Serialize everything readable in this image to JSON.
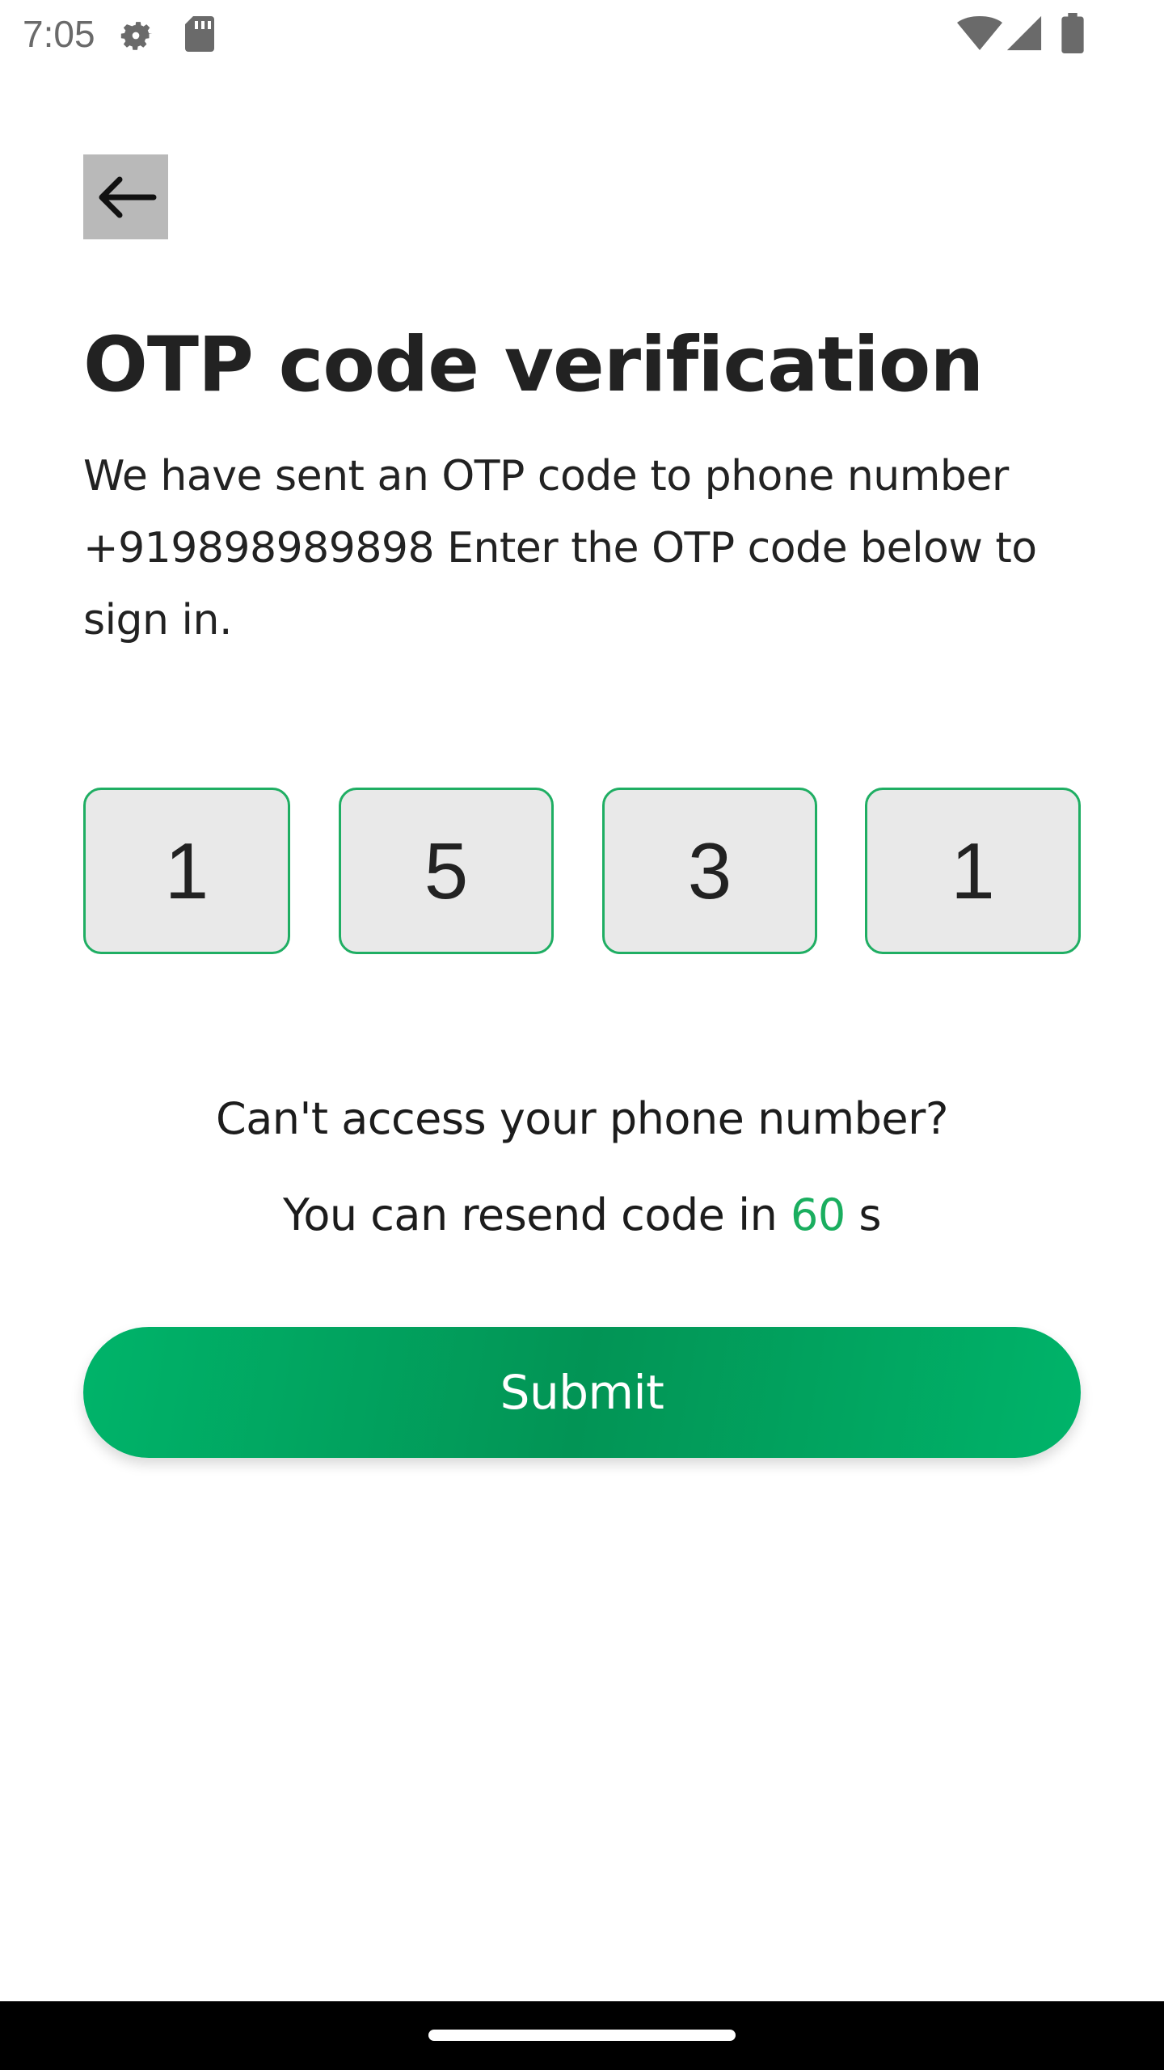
{
  "status_bar": {
    "time": "7:05",
    "icons": [
      "gear-icon",
      "sd-card-icon",
      "wifi-icon",
      "signal-icon",
      "battery-icon"
    ]
  },
  "back_button": {
    "icon": "arrow-left-icon"
  },
  "title": "OTP code verification",
  "description": "We have sent an OTP code to phone number +919898989898 Enter the OTP code below to sign in.",
  "otp": {
    "digits": [
      "1",
      "5",
      "3",
      "1"
    ],
    "border_color": "#1fae63",
    "fill_color": "#e9e9e9"
  },
  "cant_access_text": "Can't access your phone number?",
  "resend": {
    "prefix": "You can resend code in ",
    "count": "60",
    "suffix": " s",
    "count_color": "#1aae5f"
  },
  "submit": {
    "label": "Submit",
    "color": "#02a862"
  }
}
